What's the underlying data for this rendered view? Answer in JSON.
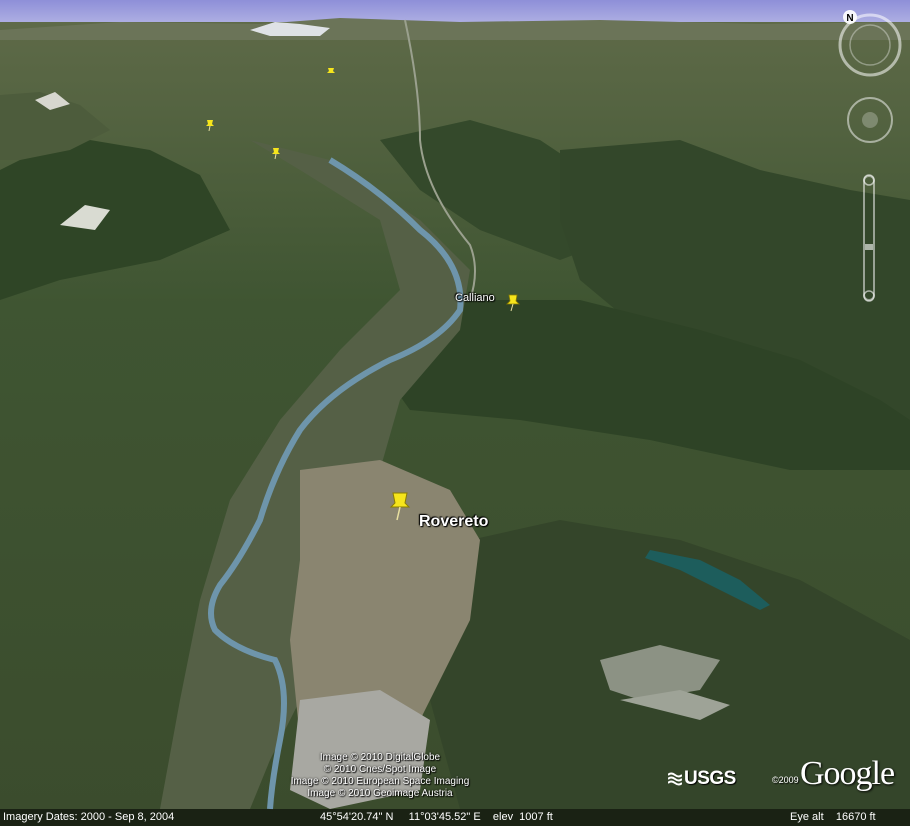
{
  "map": {
    "places": [
      {
        "id": "calliano",
        "name": "Calliano"
      },
      {
        "id": "rovereto",
        "name": "Rovereto"
      }
    ],
    "pin_color": "#f6e51c",
    "river_color": "#6e95ab"
  },
  "credits": {
    "lines": [
      "Image © 2010 DigitalGlobe",
      "© 2010 Cnes/Spot Image",
      "Image © 2010 European Space Imaging",
      "Image © 2010 Geoimage Austria"
    ],
    "usgs": "USGS",
    "google_year": "©2009",
    "google": "Google"
  },
  "status": {
    "imagery_dates": "Imagery Dates: 2000 - Sep 8, 2004",
    "coordinates": "45°54'20.74\" N     11°03'45.52\" E    elev  1007 ft",
    "eye_alt": "Eye alt    16670 ft"
  },
  "controls": {
    "north_letter": "N",
    "icons": [
      "compass-icon",
      "look-joystick-icon",
      "move-joystick-icon",
      "zoom-slider-icon"
    ]
  }
}
